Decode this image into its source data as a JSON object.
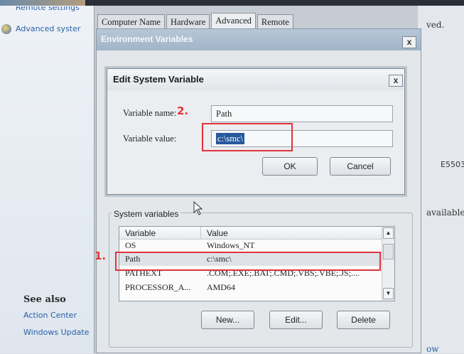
{
  "control_panel": {
    "top_link": "Remote settings",
    "advanced_link": "Advanced syster",
    "see_also": "See also",
    "action_center": "Action Center",
    "windows_update": "Windows Update",
    "right_frag_1": "ved.",
    "right_frag_2": "E5503",
    "right_frag_3": "available",
    "right_frag_4": "ow"
  },
  "system_properties": {
    "tabs": [
      "Computer Name",
      "Hardware",
      "Advanced",
      "Remote"
    ]
  },
  "environment_dialog": {
    "title": "Environment Variables",
    "close": "x",
    "system_variables_label": "System variables",
    "columns": [
      "Variable",
      "Value"
    ],
    "rows": [
      {
        "variable": "OS",
        "value": "Windows_NT"
      },
      {
        "variable": "Path",
        "value": "c:\\smc\\"
      },
      {
        "variable": "PATHEXT",
        "value": ".COM;.EXE;.BAT;.CMD;.VBS;.VBE;.JS;...."
      },
      {
        "variable": "PROCESSOR_A...",
        "value": "AMD64"
      }
    ],
    "new_button": "New...",
    "edit_button": "Edit...",
    "delete_button": "Delete"
  },
  "edit_dialog": {
    "title": "Edit System Variable",
    "close": "x",
    "name_label": "Variable name:",
    "name_value": "Path",
    "value_label": "Variable value:",
    "value_value": "c:\\smc\\",
    "ok": "OK",
    "cancel": "Cancel"
  },
  "annotations": {
    "step_one": "1.",
    "step_two": "2."
  },
  "colors": {
    "annotation_red": "#e0333c",
    "selection_blue": "#26589c",
    "link_blue": "#2b5fa6"
  }
}
